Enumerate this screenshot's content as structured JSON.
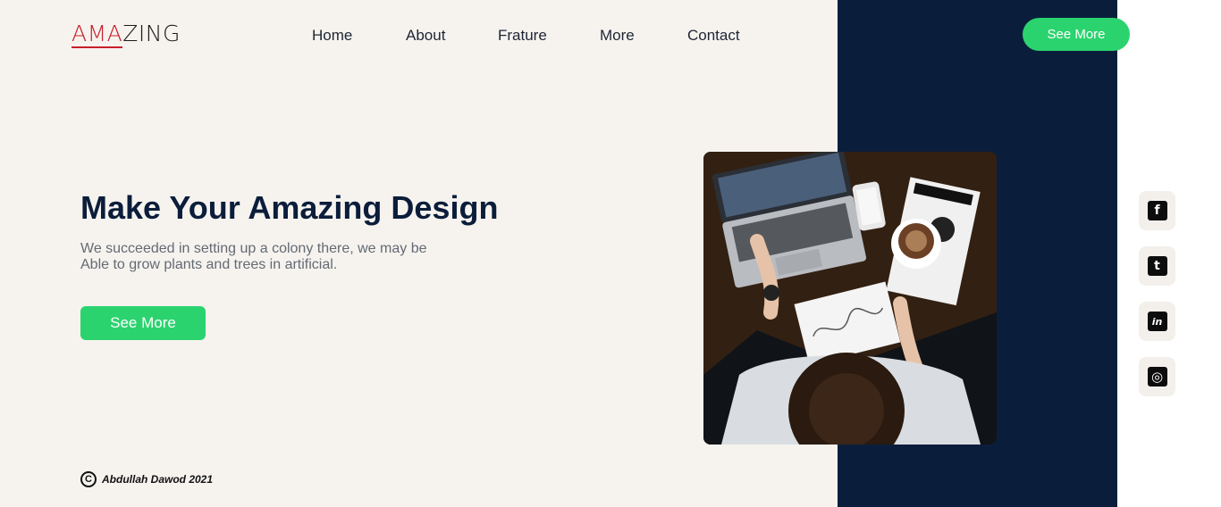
{
  "header": {
    "logo": {
      "accent": "AMA",
      "rest": "ZING"
    },
    "nav": [
      "Home",
      "About",
      "Frature",
      "More",
      "Contact"
    ],
    "cta_label": "See More"
  },
  "hero": {
    "title": "Make Your Amazing Design",
    "description_lines": [
      "We succeeded in setting up a colony there, we may be",
      "Able to grow plants and trees in artificial."
    ],
    "button_label": "See More"
  },
  "social": [
    {
      "icon": "facebook-icon",
      "glyph": "f"
    },
    {
      "icon": "twitter-icon",
      "glyph": "t"
    },
    {
      "icon": "linkedin-icon",
      "glyph": "in"
    },
    {
      "icon": "instagram-icon",
      "glyph": "◎"
    }
  ],
  "footer": {
    "copyright_symbol": "C",
    "text": "Abdullah Dawod 2021"
  },
  "colors": {
    "cream": "#f6f3ef",
    "navy": "#0a1e3c",
    "green": "#2bd36e",
    "logo_red": "#c8202b",
    "title": "#0b1d3a"
  }
}
